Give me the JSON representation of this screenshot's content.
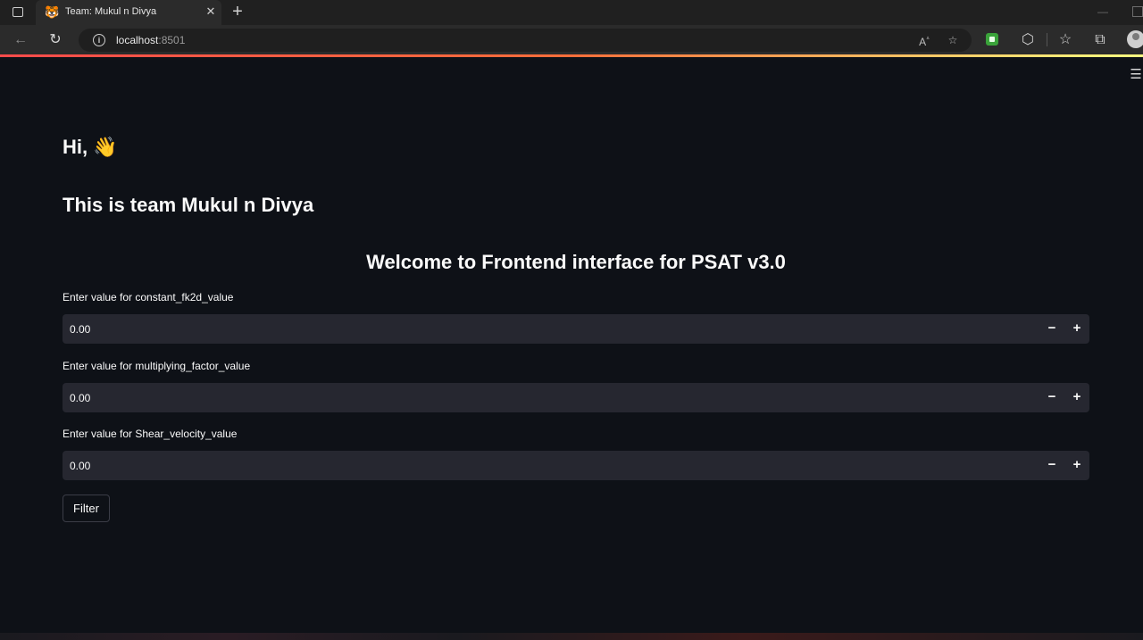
{
  "browser": {
    "tab_title": "Team: Mukul n Divya",
    "tab_favicon": "🐯",
    "url_host": "localhost",
    "url_port": ":8501",
    "icons": {
      "tab_actions": "tab-actions-icon",
      "close": "close-icon",
      "new_tab": "plus-icon",
      "back": "back-arrow-icon",
      "reload": "reload-icon",
      "info": "info-icon",
      "read_aloud": "read-aloud-icon",
      "favorite": "add-favorite-icon",
      "extension": "extension-icon",
      "extensions": "puzzle-icon",
      "favorites": "favorites-icon",
      "collections": "collections-icon",
      "profile": "profile-avatar"
    }
  },
  "app": {
    "greeting": "Hi, 👋",
    "team_heading": "This is team Mukul n Divya",
    "welcome_heading": "Welcome to Frontend interface for PSAT v3.0",
    "fields": [
      {
        "label": "Enter value for constant_fk2d_value",
        "value": "0.00"
      },
      {
        "label": "Enter value for multiplying_factor_value",
        "value": "0.00"
      },
      {
        "label": "Enter value for Shear_velocity_value",
        "value": "0.00"
      }
    ],
    "stepper_minus": "−",
    "stepper_plus": "+",
    "filter_label": "Filter",
    "accent_colors": [
      "#ff4b4b",
      "#fffd80"
    ],
    "background": "#0e1117",
    "input_background": "#262730"
  }
}
